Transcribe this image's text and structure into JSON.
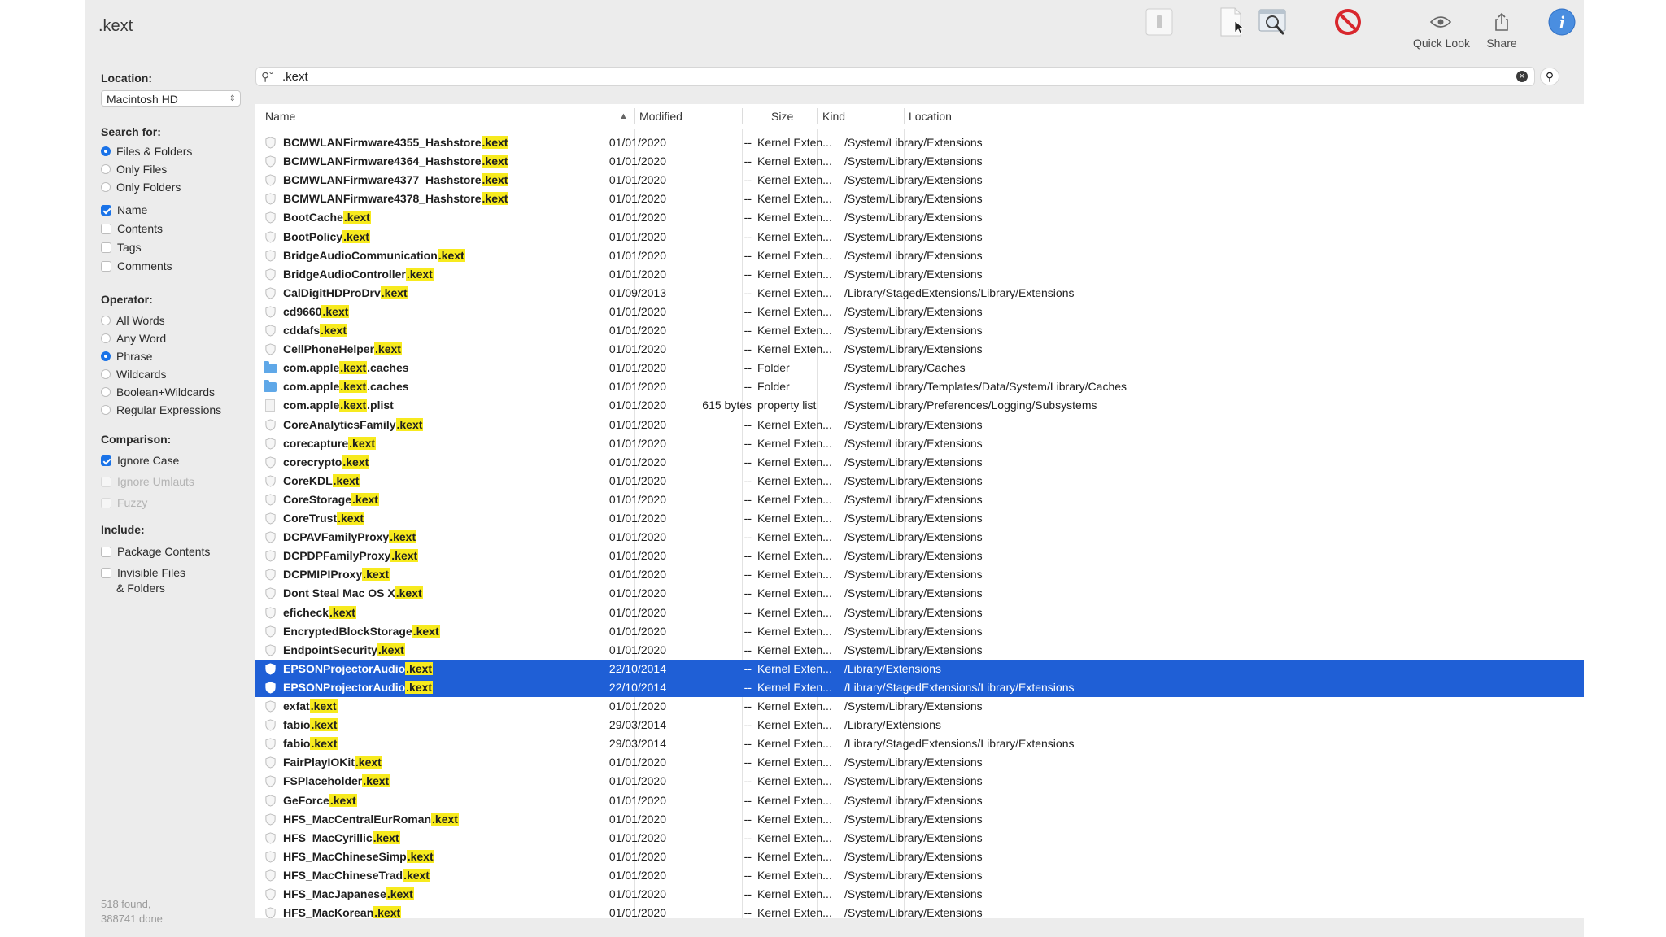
{
  "window": {
    "title": ".kext"
  },
  "toolbar": {
    "quicklook_label": "Quick Look",
    "share_label": "Share"
  },
  "sidebar": {
    "location_head": "Location:",
    "location_value": "Macintosh HD",
    "searchfor_head": "Search for:",
    "search_for": [
      "Files & Folders",
      "Only Files",
      "Only Folders"
    ],
    "name_label": "Name",
    "contents_label": "Contents",
    "tags_label": "Tags",
    "comments_label": "Comments",
    "operator_head": "Operator:",
    "operators": [
      "All Words",
      "Any Word",
      "Phrase",
      "Wildcards",
      "Boolean+Wildcards",
      "Regular Expressions"
    ],
    "comparison_head": "Comparison:",
    "ignore_case": "Ignore Case",
    "ignore_umlauts": "Ignore Umlauts",
    "fuzzy": "Fuzzy",
    "include_head": "Include:",
    "package_contents": "Package Contents",
    "invisible_1": "Invisible Files",
    "invisible_2": "& Folders",
    "status_1": "518 found,",
    "status_2": "388741 done"
  },
  "search": {
    "query": ".kext",
    "highlight": ".kext"
  },
  "columns": {
    "name": "Name",
    "modified": "Modified",
    "size": "Size",
    "kind": "Kind",
    "location": "Location"
  },
  "rows": [
    {
      "pre": "BCMWLANFirmware4355_Hashstore",
      "hl": ".kext",
      "post": "",
      "mod": "01/01/2020",
      "size": "--",
      "kind": "Kernel Exten...",
      "loc": "/System/Library/Extensions",
      "icon": "shield"
    },
    {
      "pre": "BCMWLANFirmware4364_Hashstore",
      "hl": ".kext",
      "post": "",
      "mod": "01/01/2020",
      "size": "--",
      "kind": "Kernel Exten...",
      "loc": "/System/Library/Extensions",
      "icon": "shield"
    },
    {
      "pre": "BCMWLANFirmware4377_Hashstore",
      "hl": ".kext",
      "post": "",
      "mod": "01/01/2020",
      "size": "--",
      "kind": "Kernel Exten...",
      "loc": "/System/Library/Extensions",
      "icon": "shield"
    },
    {
      "pre": "BCMWLANFirmware4378_Hashstore",
      "hl": ".kext",
      "post": "",
      "mod": "01/01/2020",
      "size": "--",
      "kind": "Kernel Exten...",
      "loc": "/System/Library/Extensions",
      "icon": "shield"
    },
    {
      "pre": "BootCache",
      "hl": ".kext",
      "post": "",
      "mod": "01/01/2020",
      "size": "--",
      "kind": "Kernel Exten...",
      "loc": "/System/Library/Extensions",
      "icon": "shield"
    },
    {
      "pre": "BootPolicy",
      "hl": ".kext",
      "post": "",
      "mod": "01/01/2020",
      "size": "--",
      "kind": "Kernel Exten...",
      "loc": "/System/Library/Extensions",
      "icon": "shield"
    },
    {
      "pre": "BridgeAudioCommunication",
      "hl": ".kext",
      "post": "",
      "mod": "01/01/2020",
      "size": "--",
      "kind": "Kernel Exten...",
      "loc": "/System/Library/Extensions",
      "icon": "shield"
    },
    {
      "pre": "BridgeAudioController",
      "hl": ".kext",
      "post": "",
      "mod": "01/01/2020",
      "size": "--",
      "kind": "Kernel Exten...",
      "loc": "/System/Library/Extensions",
      "icon": "shield"
    },
    {
      "pre": "CalDigitHDProDrv",
      "hl": ".kext",
      "post": "",
      "mod": "01/09/2013",
      "size": "--",
      "kind": "Kernel Exten...",
      "loc": "/Library/StagedExtensions/Library/Extensions",
      "icon": "shield"
    },
    {
      "pre": "cd9660",
      "hl": ".kext",
      "post": "",
      "mod": "01/01/2020",
      "size": "--",
      "kind": "Kernel Exten...",
      "loc": "/System/Library/Extensions",
      "icon": "shield"
    },
    {
      "pre": "cddafs",
      "hl": ".kext",
      "post": "",
      "mod": "01/01/2020",
      "size": "--",
      "kind": "Kernel Exten...",
      "loc": "/System/Library/Extensions",
      "icon": "shield"
    },
    {
      "pre": "CellPhoneHelper",
      "hl": ".kext",
      "post": "",
      "mod": "01/01/2020",
      "size": "--",
      "kind": "Kernel Exten...",
      "loc": "/System/Library/Extensions",
      "icon": "shield"
    },
    {
      "pre": "com.apple",
      "hl": ".kext",
      "post": ".caches",
      "mod": "01/01/2020",
      "size": "--",
      "kind": "Folder",
      "loc": "/System/Library/Caches",
      "icon": "folder"
    },
    {
      "pre": "com.apple",
      "hl": ".kext",
      "post": ".caches",
      "mod": "01/01/2020",
      "size": "--",
      "kind": "Folder",
      "loc": "/System/Library/Templates/Data/System/Library/Caches",
      "icon": "folder"
    },
    {
      "pre": "com.apple",
      "hl": ".kext",
      "post": ".plist",
      "mod": "01/01/2020",
      "size": "615 bytes",
      "kind": "property list",
      "loc": "/System/Library/Preferences/Logging/Subsystems",
      "icon": "doc"
    },
    {
      "pre": "CoreAnalyticsFamily",
      "hl": ".kext",
      "post": "",
      "mod": "01/01/2020",
      "size": "--",
      "kind": "Kernel Exten...",
      "loc": "/System/Library/Extensions",
      "icon": "shield"
    },
    {
      "pre": "corecapture",
      "hl": ".kext",
      "post": "",
      "mod": "01/01/2020",
      "size": "--",
      "kind": "Kernel Exten...",
      "loc": "/System/Library/Extensions",
      "icon": "shield"
    },
    {
      "pre": "corecrypto",
      "hl": ".kext",
      "post": "",
      "mod": "01/01/2020",
      "size": "--",
      "kind": "Kernel Exten...",
      "loc": "/System/Library/Extensions",
      "icon": "shield"
    },
    {
      "pre": "CoreKDL",
      "hl": ".kext",
      "post": "",
      "mod": "01/01/2020",
      "size": "--",
      "kind": "Kernel Exten...",
      "loc": "/System/Library/Extensions",
      "icon": "shield"
    },
    {
      "pre": "CoreStorage",
      "hl": ".kext",
      "post": "",
      "mod": "01/01/2020",
      "size": "--",
      "kind": "Kernel Exten...",
      "loc": "/System/Library/Extensions",
      "icon": "shield"
    },
    {
      "pre": "CoreTrust",
      "hl": ".kext",
      "post": "",
      "mod": "01/01/2020",
      "size": "--",
      "kind": "Kernel Exten...",
      "loc": "/System/Library/Extensions",
      "icon": "shield"
    },
    {
      "pre": "DCPAVFamilyProxy",
      "hl": ".kext",
      "post": "",
      "mod": "01/01/2020",
      "size": "--",
      "kind": "Kernel Exten...",
      "loc": "/System/Library/Extensions",
      "icon": "shield"
    },
    {
      "pre": "DCPDPFamilyProxy",
      "hl": ".kext",
      "post": "",
      "mod": "01/01/2020",
      "size": "--",
      "kind": "Kernel Exten...",
      "loc": "/System/Library/Extensions",
      "icon": "shield"
    },
    {
      "pre": "DCPMIPIProxy",
      "hl": ".kext",
      "post": "",
      "mod": "01/01/2020",
      "size": "--",
      "kind": "Kernel Exten...",
      "loc": "/System/Library/Extensions",
      "icon": "shield"
    },
    {
      "pre": "Dont Steal Mac OS X",
      "hl": ".kext",
      "post": "",
      "mod": "01/01/2020",
      "size": "--",
      "kind": "Kernel Exten...",
      "loc": "/System/Library/Extensions",
      "icon": "shield"
    },
    {
      "pre": "eficheck",
      "hl": ".kext",
      "post": "",
      "mod": "01/01/2020",
      "size": "--",
      "kind": "Kernel Exten...",
      "loc": "/System/Library/Extensions",
      "icon": "shield"
    },
    {
      "pre": "EncryptedBlockStorage",
      "hl": ".kext",
      "post": "",
      "mod": "01/01/2020",
      "size": "--",
      "kind": "Kernel Exten...",
      "loc": "/System/Library/Extensions",
      "icon": "shield"
    },
    {
      "pre": "EndpointSecurity",
      "hl": ".kext",
      "post": "",
      "mod": "01/01/2020",
      "size": "--",
      "kind": "Kernel Exten...",
      "loc": "/System/Library/Extensions",
      "icon": "shield"
    },
    {
      "pre": "EPSONProjectorAudio",
      "hl": ".kext",
      "post": "",
      "mod": "22/10/2014",
      "size": "--",
      "kind": "Kernel Exten...",
      "loc": "/Library/Extensions",
      "icon": "shield",
      "selected": true
    },
    {
      "pre": "EPSONProjectorAudio",
      "hl": ".kext",
      "post": "",
      "mod": "22/10/2014",
      "size": "--",
      "kind": "Kernel Exten...",
      "loc": "/Library/StagedExtensions/Library/Extensions",
      "icon": "shield",
      "selected": true
    },
    {
      "pre": "exfat",
      "hl": ".kext",
      "post": "",
      "mod": "01/01/2020",
      "size": "--",
      "kind": "Kernel Exten...",
      "loc": "/System/Library/Extensions",
      "icon": "shield"
    },
    {
      "pre": "fabio",
      "hl": ".kext",
      "post": "",
      "mod": "29/03/2014",
      "size": "--",
      "kind": "Kernel Exten...",
      "loc": "/Library/Extensions",
      "icon": "shield"
    },
    {
      "pre": "fabio",
      "hl": ".kext",
      "post": "",
      "mod": "29/03/2014",
      "size": "--",
      "kind": "Kernel Exten...",
      "loc": "/Library/StagedExtensions/Library/Extensions",
      "icon": "shield"
    },
    {
      "pre": "FairPlayIOKit",
      "hl": ".kext",
      "post": "",
      "mod": "01/01/2020",
      "size": "--",
      "kind": "Kernel Exten...",
      "loc": "/System/Library/Extensions",
      "icon": "shield"
    },
    {
      "pre": "FSPlaceholder",
      "hl": ".kext",
      "post": "",
      "mod": "01/01/2020",
      "size": "--",
      "kind": "Kernel Exten...",
      "loc": "/System/Library/Extensions",
      "icon": "shield"
    },
    {
      "pre": "GeForce",
      "hl": ".kext",
      "post": "",
      "mod": "01/01/2020",
      "size": "--",
      "kind": "Kernel Exten...",
      "loc": "/System/Library/Extensions",
      "icon": "shield"
    },
    {
      "pre": "HFS_MacCentralEurRoman",
      "hl": ".kext",
      "post": "",
      "mod": "01/01/2020",
      "size": "--",
      "kind": "Kernel Exten...",
      "loc": "/System/Library/Extensions",
      "icon": "shield"
    },
    {
      "pre": "HFS_MacCyrillic",
      "hl": ".kext",
      "post": "",
      "mod": "01/01/2020",
      "size": "--",
      "kind": "Kernel Exten...",
      "loc": "/System/Library/Extensions",
      "icon": "shield"
    },
    {
      "pre": "HFS_MacChineseSimp",
      "hl": ".kext",
      "post": "",
      "mod": "01/01/2020",
      "size": "--",
      "kind": "Kernel Exten...",
      "loc": "/System/Library/Extensions",
      "icon": "shield"
    },
    {
      "pre": "HFS_MacChineseTrad",
      "hl": ".kext",
      "post": "",
      "mod": "01/01/2020",
      "size": "--",
      "kind": "Kernel Exten...",
      "loc": "/System/Library/Extensions",
      "icon": "shield"
    },
    {
      "pre": "HFS_MacJapanese",
      "hl": ".kext",
      "post": "",
      "mod": "01/01/2020",
      "size": "--",
      "kind": "Kernel Exten...",
      "loc": "/System/Library/Extensions",
      "icon": "shield"
    },
    {
      "pre": "HFS_MacKorean",
      "hl": ".kext",
      "post": "",
      "mod": "01/01/2020",
      "size": "--",
      "kind": "Kernel Exten...",
      "loc": "/System/Library/Extensions",
      "icon": "shield"
    }
  ],
  "colors": {
    "accent": "#1f5fd6",
    "highlight": "#f7ea1e",
    "forbidden": "#d8272d",
    "info": "#4a8ee0"
  }
}
